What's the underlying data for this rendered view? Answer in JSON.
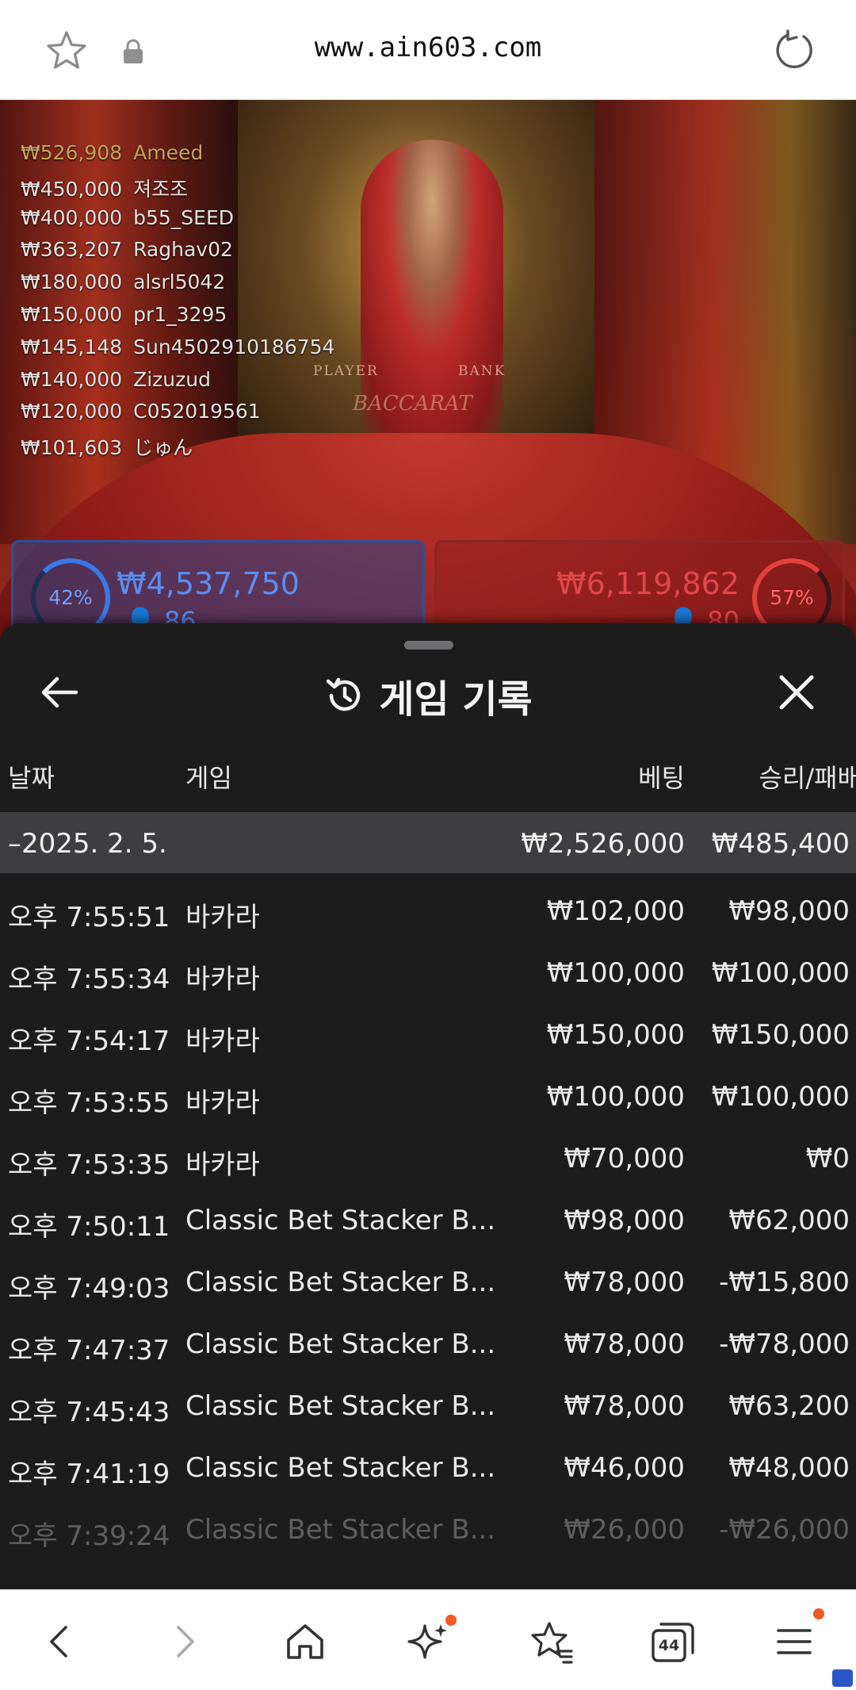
{
  "browser": {
    "url": "www.ain603.com",
    "tabs_count": "44"
  },
  "video": {
    "felt_player": "PLAYER",
    "felt_banker": "BANK",
    "felt_logo": "BACCARAT",
    "leaderboard": [
      {
        "amount": "₩526,908",
        "name": "Ameed"
      },
      {
        "amount": "₩450,000",
        "name": "져조조"
      },
      {
        "amount": "₩400,000",
        "name": "b55_SEED"
      },
      {
        "amount": "₩363,207",
        "name": "Raghav02"
      },
      {
        "amount": "₩180,000",
        "name": "alsrl5042"
      },
      {
        "amount": "₩150,000",
        "name": "pr1_3295"
      },
      {
        "amount": "₩145,148",
        "name": "Sun4502910186754"
      },
      {
        "amount": "₩140,000",
        "name": "Zizuzud"
      },
      {
        "amount": "₩120,000",
        "name": "C052019561"
      },
      {
        "amount": "₩101,603",
        "name": "じゅん"
      }
    ],
    "player_bets": {
      "percent": "42%",
      "total": "₩4,537,750",
      "count": "86"
    },
    "banker_bets": {
      "percent": "57%",
      "total": "₩6,119,862",
      "count": "80"
    }
  },
  "history": {
    "title": "게임 기록",
    "columns": {
      "date": "날짜",
      "game": "게임",
      "bet": "베팅",
      "winloss": "승리/패배"
    },
    "day": {
      "date": "–2025. 2. 5.",
      "bet": "₩2,526,000",
      "winloss": "₩485,400"
    },
    "rows": [
      {
        "time": "오후 7:55:51",
        "game": "바카라",
        "bet": "₩102,000",
        "winloss": "₩98,000"
      },
      {
        "time": "오후 7:55:34",
        "game": "바카라",
        "bet": "₩100,000",
        "winloss": "₩100,000"
      },
      {
        "time": "오후 7:54:17",
        "game": "바카라",
        "bet": "₩150,000",
        "winloss": "₩150,000"
      },
      {
        "time": "오후 7:53:55",
        "game": "바카라",
        "bet": "₩100,000",
        "winloss": "₩100,000"
      },
      {
        "time": "오후 7:53:35",
        "game": "바카라",
        "bet": "₩70,000",
        "winloss": "₩0"
      },
      {
        "time": "오후 7:50:11",
        "game": "Classic Bet Stacker B...",
        "bet": "₩98,000",
        "winloss": "₩62,000"
      },
      {
        "time": "오후 7:49:03",
        "game": "Classic Bet Stacker B...",
        "bet": "₩78,000",
        "winloss": "-₩15,800"
      },
      {
        "time": "오후 7:47:37",
        "game": "Classic Bet Stacker B...",
        "bet": "₩78,000",
        "winloss": "-₩78,000"
      },
      {
        "time": "오후 7:45:43",
        "game": "Classic Bet Stacker B...",
        "bet": "₩78,000",
        "winloss": "₩63,200"
      },
      {
        "time": "오후 7:41:19",
        "game": "Classic Bet Stacker B...",
        "bet": "₩46,000",
        "winloss": "₩48,000"
      },
      {
        "time": "오후 7:39:24",
        "game": "Classic Bet Stacker B...",
        "bet": "₩26,000",
        "winloss": "-₩26,000"
      }
    ]
  },
  "icons": {
    "top": [
      "star-icon",
      "lock-icon",
      "reload-icon"
    ],
    "sheet": [
      "back-arrow-icon",
      "history-icon",
      "close-icon"
    ],
    "bottom": [
      "back-icon",
      "forward-icon",
      "home-icon",
      "sparkle-icon",
      "star-list-icon",
      "tabs-icon",
      "menu-icon"
    ]
  },
  "colors": {
    "sheet_bg": "#1c1c1d",
    "day_row_bg": "#3e3e40",
    "player_blue": "#5b8df2",
    "banker_red": "#e04848",
    "notification_dot": "#f15a24"
  }
}
